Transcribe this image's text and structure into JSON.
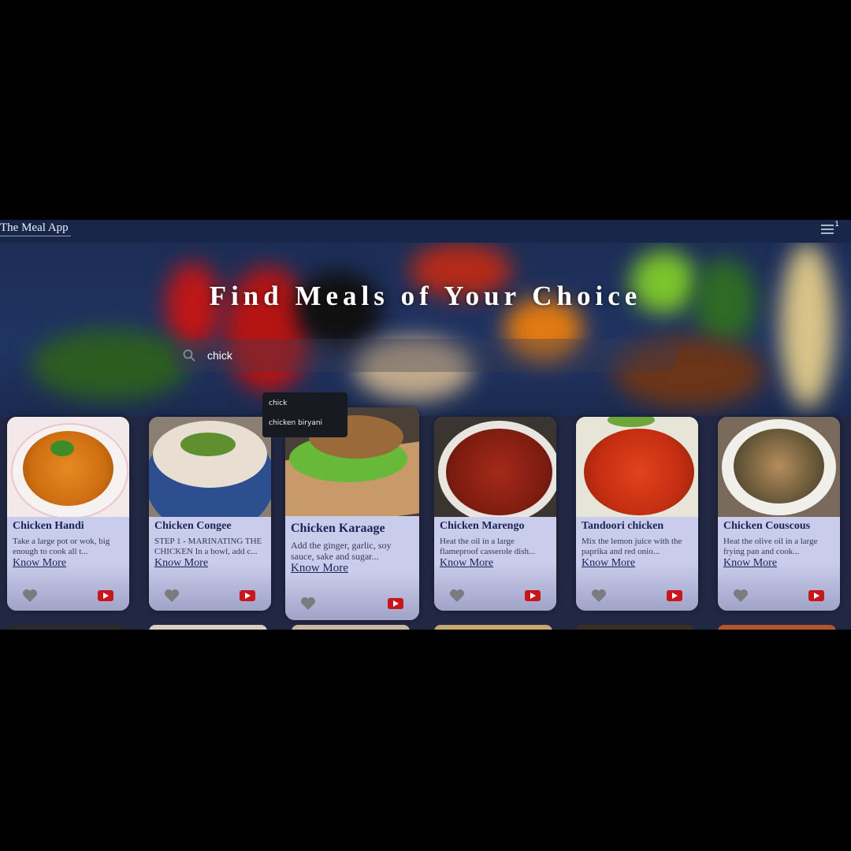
{
  "navbar": {
    "brand": "The Meal App",
    "menu_badge": "1"
  },
  "hero": {
    "title": "Find Meals of Your Choice"
  },
  "search": {
    "value": "chick",
    "suggestions": [
      "chick",
      "chicken biryani"
    ]
  },
  "cards": [
    {
      "title": "Chicken Handi",
      "desc": "Take a large pot or wok, big enough to cook all t...",
      "link": "Know More"
    },
    {
      "title": "Chicken Congee",
      "desc": "STEP 1 - MARINATING THE CHICKEN In a bowl, add c...",
      "link": "Know More"
    },
    {
      "title": "Chicken Karaage",
      "desc": "Add the ginger, garlic, soy sauce, sake and sugar...",
      "link": "Know More"
    },
    {
      "title": "Chicken Marengo",
      "desc": "Heat the oil in a large flameproof casserole dish...",
      "link": "Know More"
    },
    {
      "title": "Tandoori chicken",
      "desc": "Mix the lemon juice with the paprika and red onio...",
      "link": "Know More"
    },
    {
      "title": "Chicken Couscous",
      "desc": "Heat the olive oil in a large frying pan and cook...",
      "link": "Know More"
    }
  ],
  "colors": {
    "navbar": "#18264a",
    "card": "#c9ccea",
    "title_text": "#1c2357",
    "youtube": "#c8161d"
  }
}
